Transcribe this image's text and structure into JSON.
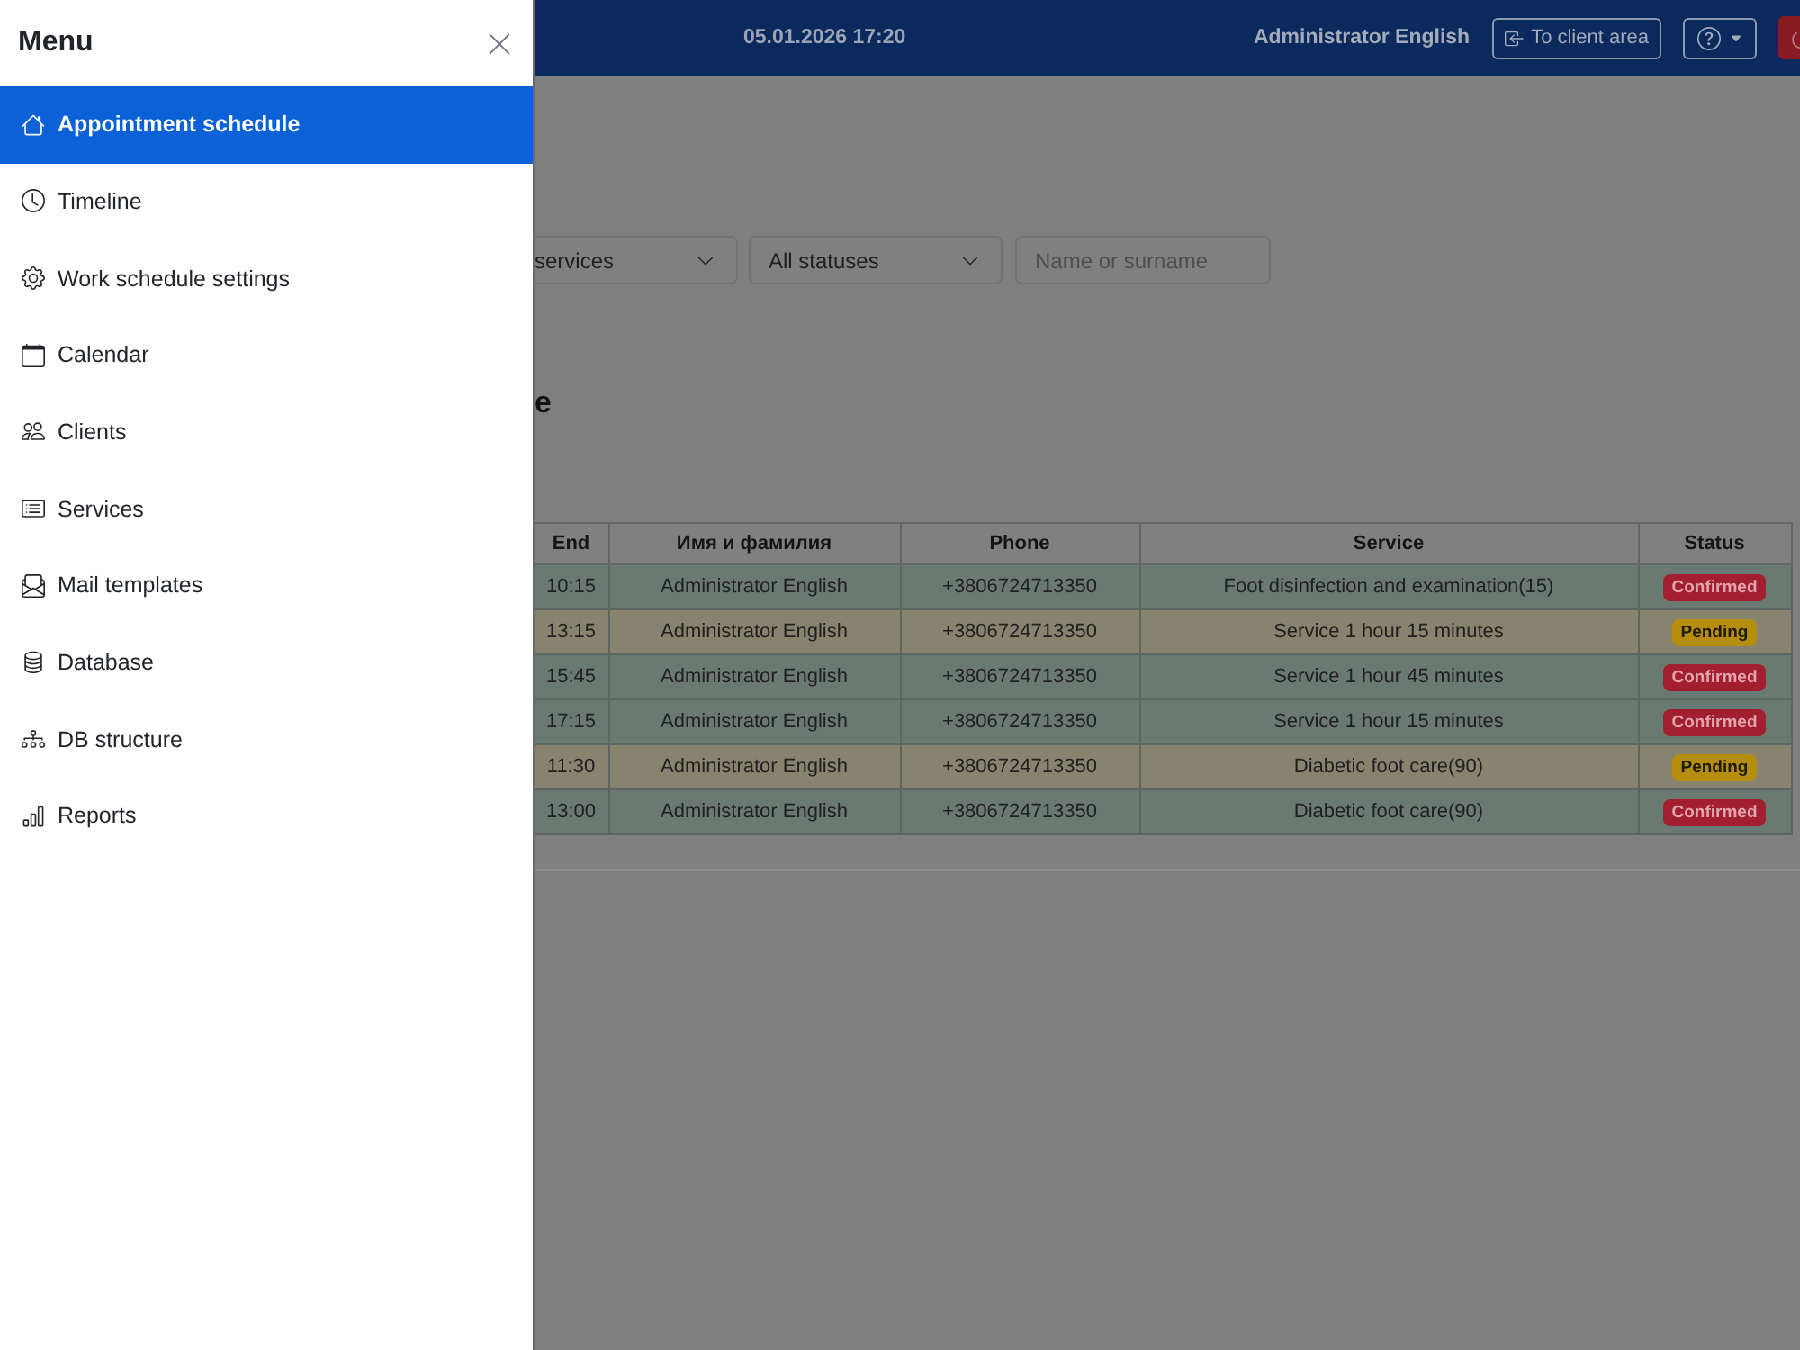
{
  "menu": {
    "title": "Menu",
    "items": [
      {
        "label": "Appointment schedule",
        "selected": true
      },
      {
        "label": "Timeline",
        "selected": false
      },
      {
        "label": "Work schedule settings",
        "selected": false
      },
      {
        "label": "Calendar",
        "selected": false
      },
      {
        "label": "Clients",
        "selected": false
      },
      {
        "label": "Services",
        "selected": false
      },
      {
        "label": "Mail templates",
        "selected": false
      },
      {
        "label": "Database",
        "selected": false
      },
      {
        "label": "DB structure",
        "selected": false
      },
      {
        "label": "Reports",
        "selected": false
      }
    ]
  },
  "header": {
    "datetime": "05.01.2026 17:20",
    "user_name": "Administrator English",
    "client_area_button": "To client area"
  },
  "filters": {
    "service_select": "services",
    "status_select": "All statuses",
    "search": {
      "placeholder": "Name or surname"
    }
  },
  "section_title": "e",
  "table": {
    "columns": [
      "End",
      "Имя и фамилия",
      "Phone",
      "Service",
      "Status"
    ],
    "rows": [
      {
        "end": "10:15",
        "name": "Administrator English",
        "phone": "+3806724713350",
        "service": "Foot disinfection and examination(15)",
        "status": "Confirmed",
        "kind": "confirmed"
      },
      {
        "end": "13:15",
        "name": "Administrator English",
        "phone": "+3806724713350",
        "service": "Service 1 hour 15 minutes",
        "status": "Pending",
        "kind": "pending"
      },
      {
        "end": "15:45",
        "name": "Administrator English",
        "phone": "+3806724713350",
        "service": "Service 1 hour 45 minutes",
        "status": "Confirmed",
        "kind": "confirmed"
      },
      {
        "end": "17:15",
        "name": "Administrator English",
        "phone": "+3806724713350",
        "service": "Service 1 hour 15 minutes",
        "status": "Confirmed",
        "kind": "confirmed"
      },
      {
        "end": "11:30",
        "name": "Administrator English",
        "phone": "+3806724713350",
        "service": "Diabetic foot care(90)",
        "status": "Pending",
        "kind": "pending"
      },
      {
        "end": "13:00",
        "name": "Administrator English",
        "phone": "+3806724713350",
        "service": "Diabetic foot care(90)",
        "status": "Confirmed",
        "kind": "confirmed"
      }
    ]
  }
}
